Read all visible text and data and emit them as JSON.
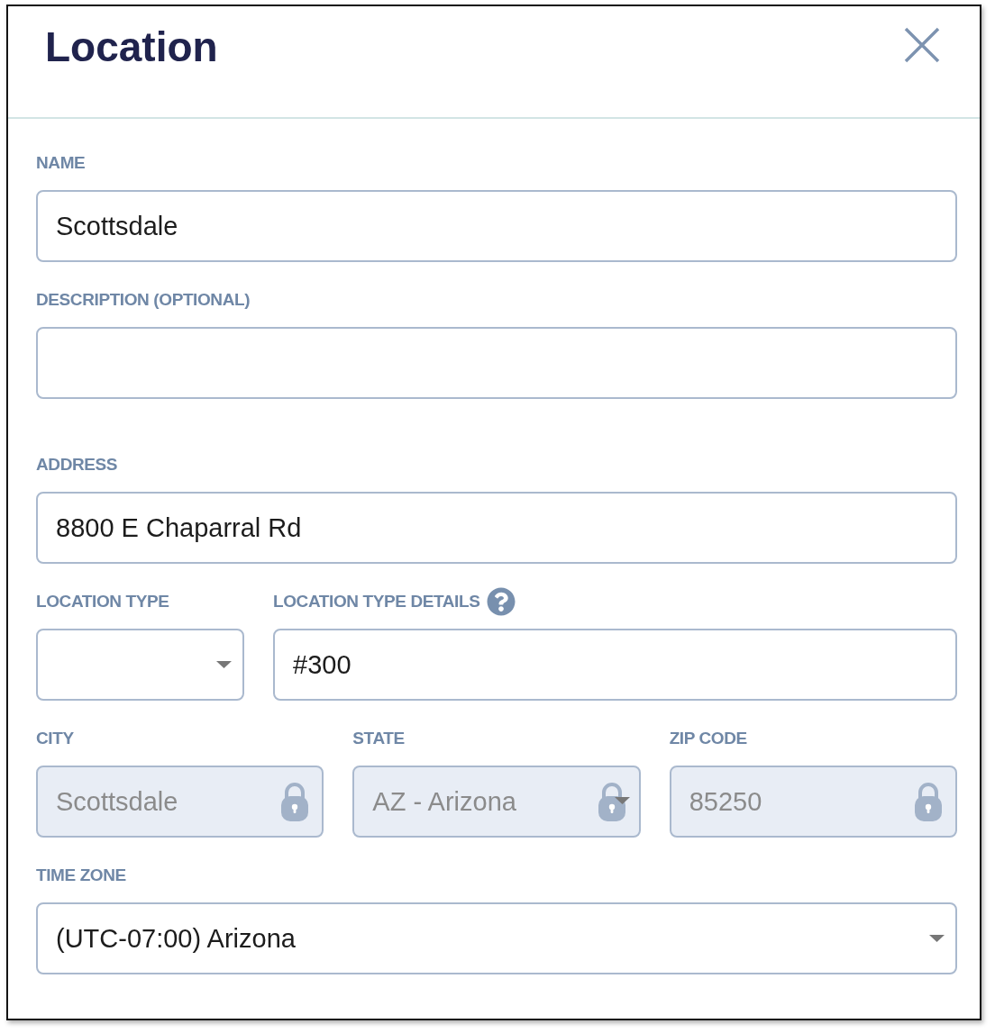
{
  "dialog": {
    "title": "Location"
  },
  "sections": [
    {
      "rows": [
        {
          "fields": [
            {
              "kind": "text",
              "label": "NAME",
              "value": "Scottsdale",
              "disabled": false,
              "help": false
            }
          ]
        },
        {
          "fields": [
            {
              "kind": "text",
              "label": "DESCRIPTION (OPTIONAL)",
              "disabled": false,
              "help": false
            }
          ]
        }
      ]
    },
    {
      "rows": [
        {
          "fields": [
            {
              "kind": "text",
              "label": "ADDRESS",
              "value": "8800 E Chaparral Rd",
              "disabled": false,
              "help": false
            }
          ]
        },
        {
          "fields": [
            {
              "kind": "select",
              "label": "LOCATION TYPE",
              "disabled": false,
              "help": false
            },
            {
              "kind": "text",
              "label": "LOCATION TYPE DETAILS",
              "value": "#300",
              "disabled": false,
              "help": true
            }
          ]
        },
        {
          "fields": [
            {
              "kind": "text",
              "label": "CITY",
              "value": "Scottsdale",
              "disabled": true,
              "help": false
            },
            {
              "kind": "select",
              "label": "STATE",
              "value": "AZ - Arizona",
              "disabled": true,
              "help": false
            },
            {
              "kind": "text",
              "label": "ZIP CODE",
              "value": "85250",
              "disabled": true,
              "help": false
            }
          ]
        },
        {
          "fields": [
            {
              "kind": "select",
              "label": "TIME ZONE",
              "value": "(UTC-07:00) Arizona",
              "disabled": false,
              "help": false
            }
          ]
        }
      ]
    }
  ]
}
